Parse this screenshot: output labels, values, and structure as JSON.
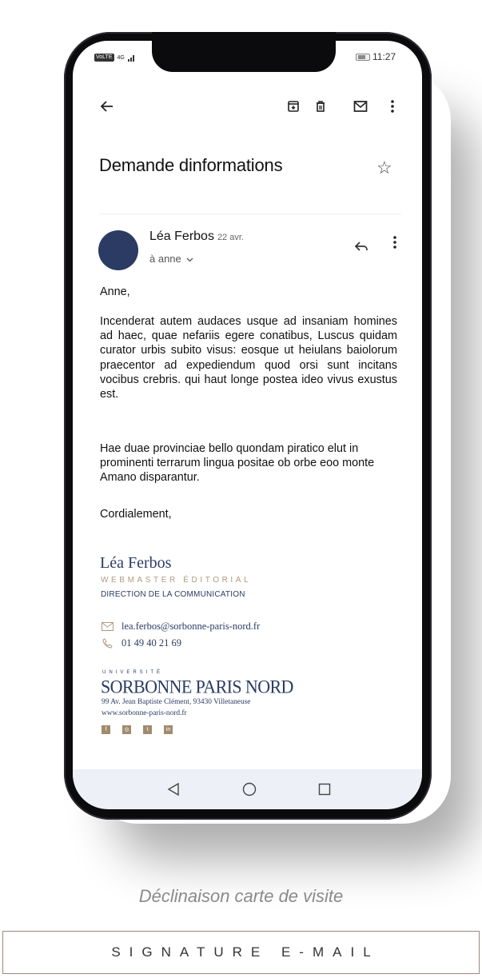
{
  "status_bar": {
    "left_text": "VoLTE",
    "signal": "4G",
    "time": "11:27"
  },
  "toolbar": {
    "back_icon": "arrow-left",
    "archive_icon": "archive",
    "delete_icon": "trash",
    "mail_icon": "envelope",
    "more_icon": "vertical-dots"
  },
  "email": {
    "subject": "Demande dinformations",
    "sender": "Léa Ferbos",
    "date": "22 avr.",
    "recipient": "à anne",
    "greeting": "Anne,",
    "paragraph1": "Incenderat autem audaces usque ad insaniam homines ad haec, quae nefariis egere conatibus, Luscus quidam curator urbis subito visus: eosque ut heiulans baiolorum praecentor ad expediendum quod orsi sunt incitans vocibus crebris. qui haut longe postea ideo vivus exustus est.",
    "paragraph2": "Hae duae provinciae bello quondam piratico elut in prominenti terrarum lingua positae ob orbe eoo monte Amano disparantur.",
    "closing": "Cordialement,"
  },
  "signature": {
    "name": "Léa Ferbos",
    "role": "WEBMASTER ÉDITORIAL",
    "department": "DIRECTION DE LA COMMUNICATION",
    "email": "lea.ferbos@sorbonne-paris-nord.fr",
    "phone": "01 49 40 21 69",
    "university_small": "UNIVERSITÉ",
    "university_name": "SORBONNE PARIS NORD",
    "address": "99 Av. Jean Baptiste Clément, 93430 Villetaneuse",
    "website": "www.sorbonne-paris-nord.fr",
    "socials": [
      "f",
      "◎",
      "t",
      "in"
    ]
  },
  "caption": "Déclinaison carte de visite",
  "footer_label": "SIGNATURE E-MAIL",
  "colors": {
    "navy": "#2c3b63",
    "gold": "#b09a82",
    "nav_bg": "#eef0f7"
  }
}
